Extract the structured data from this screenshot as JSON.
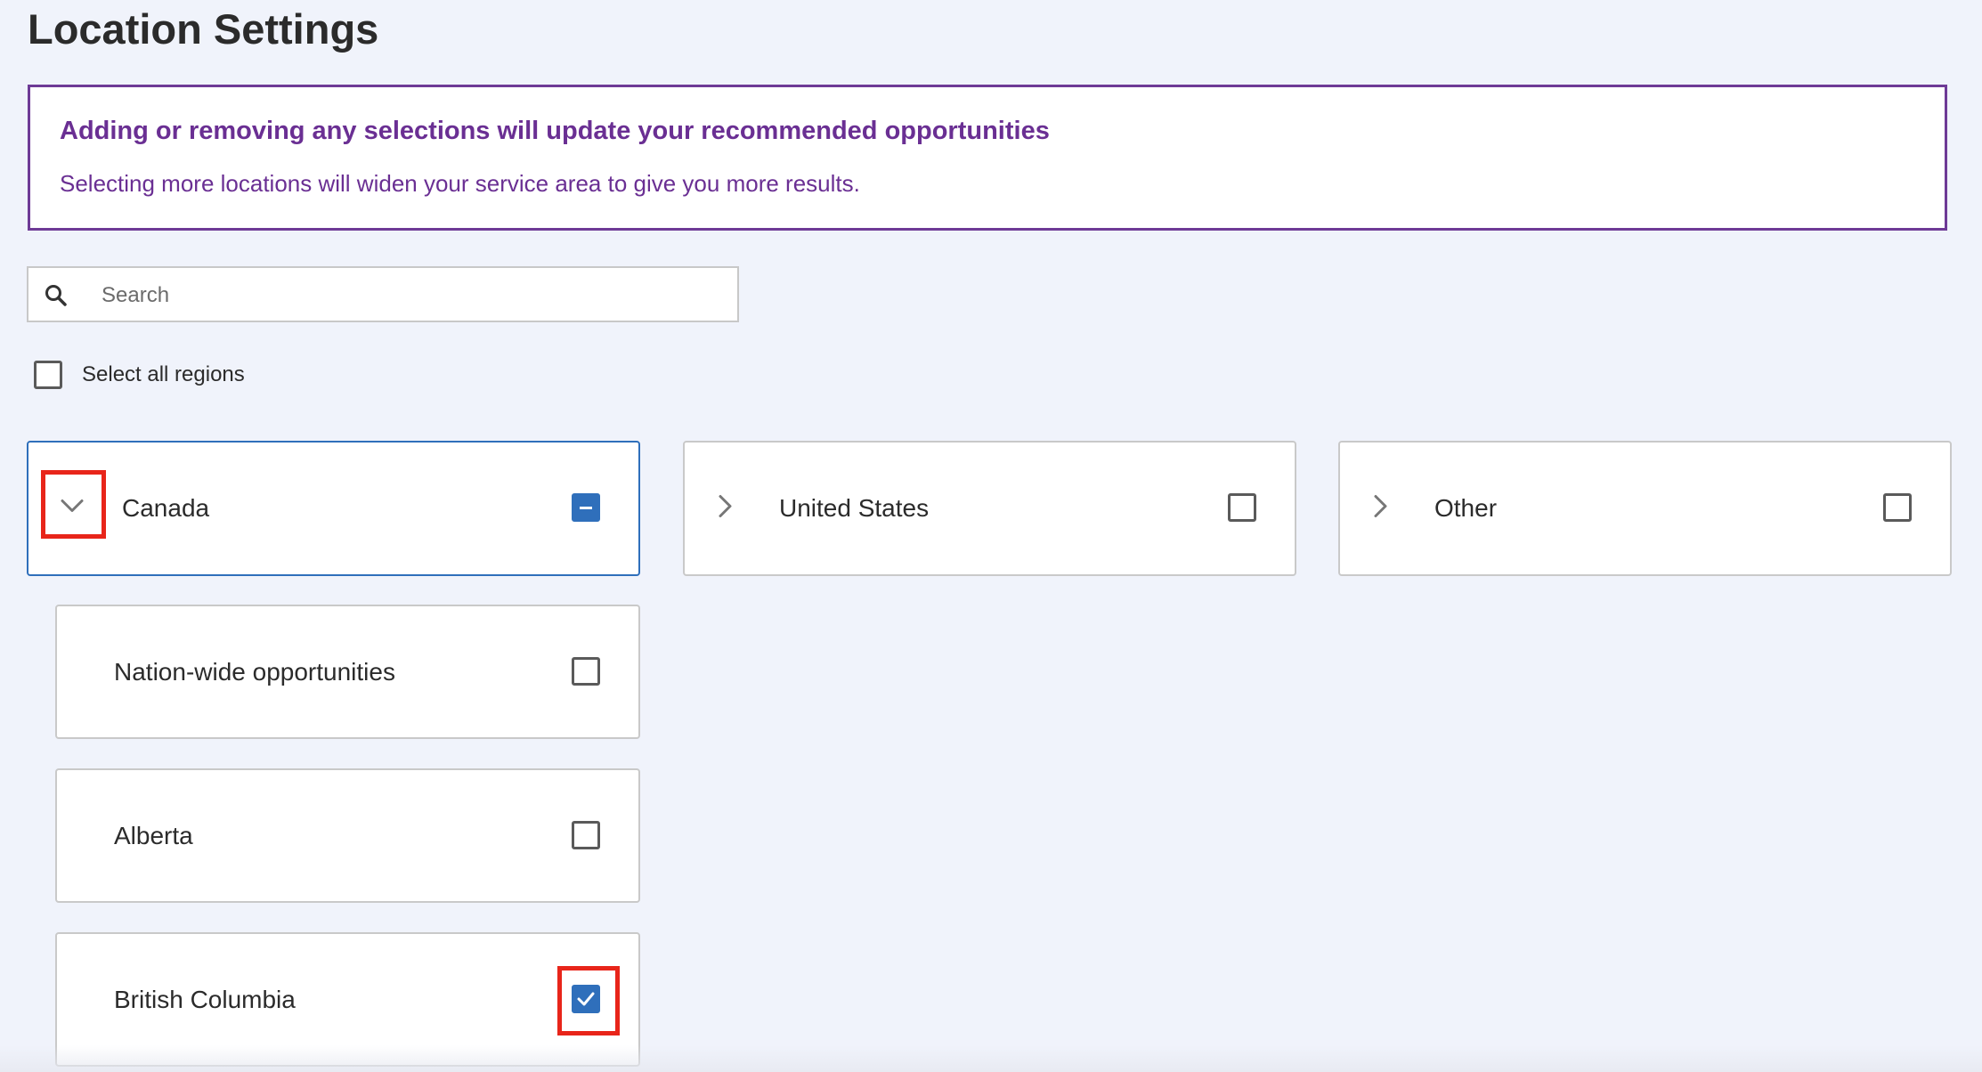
{
  "page": {
    "title": "Location Settings"
  },
  "banner": {
    "heading": "Adding or removing any selections will update your recommended opportunities",
    "text": "Selecting more locations will widen your service area to give you more results."
  },
  "search": {
    "placeholder": "Search",
    "value": ""
  },
  "select_all": {
    "label": "Select all regions",
    "checked": false
  },
  "regions": [
    {
      "label": "Canada",
      "state": "indeterminate",
      "expanded": true
    },
    {
      "label": "United States",
      "state": "unchecked",
      "expanded": false
    },
    {
      "label": "Other",
      "state": "unchecked",
      "expanded": false
    }
  ],
  "subregions": [
    {
      "label": "Nation-wide opportunities",
      "checked": false
    },
    {
      "label": "Alberta",
      "checked": false
    },
    {
      "label": "British Columbia",
      "checked": true
    }
  ],
  "colors": {
    "banner_accent": "#6a2f93",
    "checkbox_selected": "#2f6fbb",
    "annotation_highlight": "#e8251a",
    "page_background": "#f0f3fb"
  },
  "icons": {
    "search": "search-icon",
    "expand": "chevron-down-icon",
    "collapse": "chevron-right-icon",
    "check": "check-icon",
    "indeterminate": "minus-icon"
  }
}
